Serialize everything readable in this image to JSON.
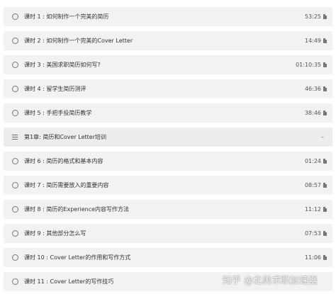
{
  "lessons": [
    {
      "title": "课时 1 : 如何制作一个完美的简历",
      "duration": "53:25",
      "icon": "circle-icon"
    },
    {
      "title": "课时 2 : 如何制作一个完美的Cover Letter",
      "duration": "14:49",
      "icon": "circle-icon"
    },
    {
      "title": "课时 3 : 美国求职简历如何写?",
      "duration": "01:10:35",
      "icon": "circle-icon"
    },
    {
      "title": "课时 4 : 留学生简历测评",
      "duration": "46:36",
      "icon": "circle-icon"
    },
    {
      "title": "课时 5 : 手把手投简历教学",
      "duration": "38:46",
      "icon": "circle-icon"
    }
  ],
  "chapter": {
    "title": "第1章: 简历和Cover Letter培训",
    "toggle": "–",
    "icon": "list-icon"
  },
  "lessons2": [
    {
      "title": "课时 6 : 简历的格式和基本内容",
      "duration": "01:24",
      "icon": "circle-icon"
    },
    {
      "title": "课时 7 : 简历需要放入的重要内容",
      "duration": "08:57",
      "icon": "circle-icon"
    },
    {
      "title": "课时 8 : 简历的Experience内容写作方法",
      "duration": "11:12",
      "icon": "circle-icon"
    },
    {
      "title": "课时 9 : 其他部分怎么写",
      "duration": "07:53",
      "icon": "circle-icon"
    },
    {
      "title": "课时 10 : Cover Letter的作用和写作方式",
      "duration": "11:06",
      "icon": "circle-icon"
    },
    {
      "title": "课时 11 : Cover Letter的写作技巧",
      "duration": "",
      "icon": "circle-icon"
    }
  ],
  "watermark": "知乎 @北美求职加速器"
}
